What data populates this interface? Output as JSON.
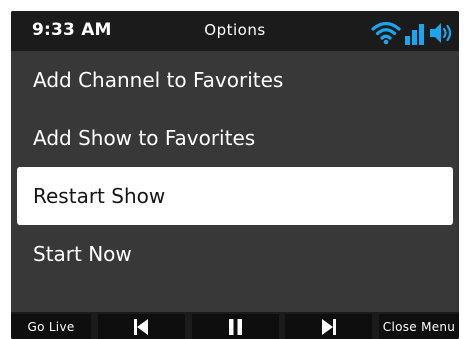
{
  "status_bar": {
    "time": "9:33 AM",
    "title": "Options",
    "icons": [
      "wifi-icon",
      "signal-bars-icon",
      "volume-icon"
    ],
    "accent_color": "#1aa6ef"
  },
  "menu": {
    "items": [
      {
        "label": "Add Channel to Favorites",
        "selected": false
      },
      {
        "label": "Add Show to Favorites",
        "selected": false
      },
      {
        "label": "Restart Show",
        "selected": true
      },
      {
        "label": "Start Now",
        "selected": false
      }
    ]
  },
  "controls": {
    "go_live_label": "Go Live",
    "previous_icon": "skip-previous-icon",
    "pause_icon": "pause-icon",
    "next_icon": "skip-next-icon",
    "close_menu_label": "Close Menu"
  }
}
